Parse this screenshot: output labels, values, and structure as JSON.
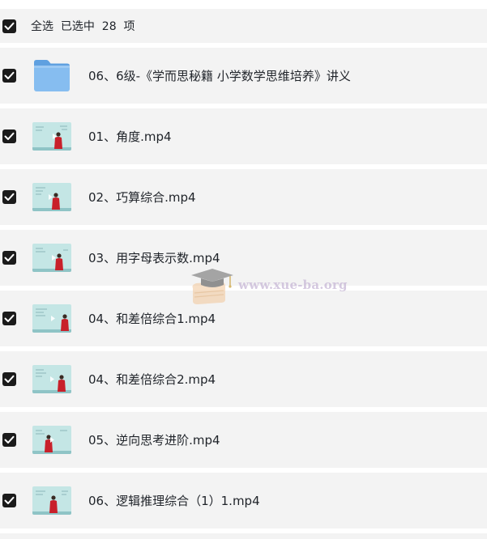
{
  "selection": {
    "checked": true,
    "label": "全选  已选中  28  项"
  },
  "files": [
    {
      "kind": "folder",
      "icon": "folder-icon",
      "name": "06、6级-《学而思秘籍 小学数学思维培养》讲义",
      "checked": true
    },
    {
      "kind": "video",
      "icon": "video-thumbnail",
      "name": "01、角度.mp4",
      "checked": true
    },
    {
      "kind": "video",
      "icon": "video-thumbnail",
      "name": "02、巧算综合.mp4",
      "checked": true
    },
    {
      "kind": "video",
      "icon": "video-thumbnail",
      "name": "03、用字母表示数.mp4",
      "checked": true
    },
    {
      "kind": "video",
      "icon": "video-thumbnail",
      "name": "04、和差倍综合1.mp4",
      "checked": true
    },
    {
      "kind": "video",
      "icon": "video-thumbnail",
      "name": "04、和差倍综合2.mp4",
      "checked": true
    },
    {
      "kind": "video",
      "icon": "video-thumbnail",
      "name": "05、逆向思考进阶.mp4",
      "checked": true
    },
    {
      "kind": "video",
      "icon": "video-thumbnail",
      "name": "06、逻辑推理综合（1）1.mp4",
      "checked": true
    }
  ],
  "watermark": {
    "text": "www.xue-ba.org",
    "icon": "graduation-cap-books-logo"
  },
  "colors": {
    "row_background": "#f3f3f3",
    "checkbox": "#1b1b1b",
    "folder": "#7db6ec",
    "thumbnail_board": "#bfe3e3",
    "presenter_shirt": "#c8202a"
  }
}
